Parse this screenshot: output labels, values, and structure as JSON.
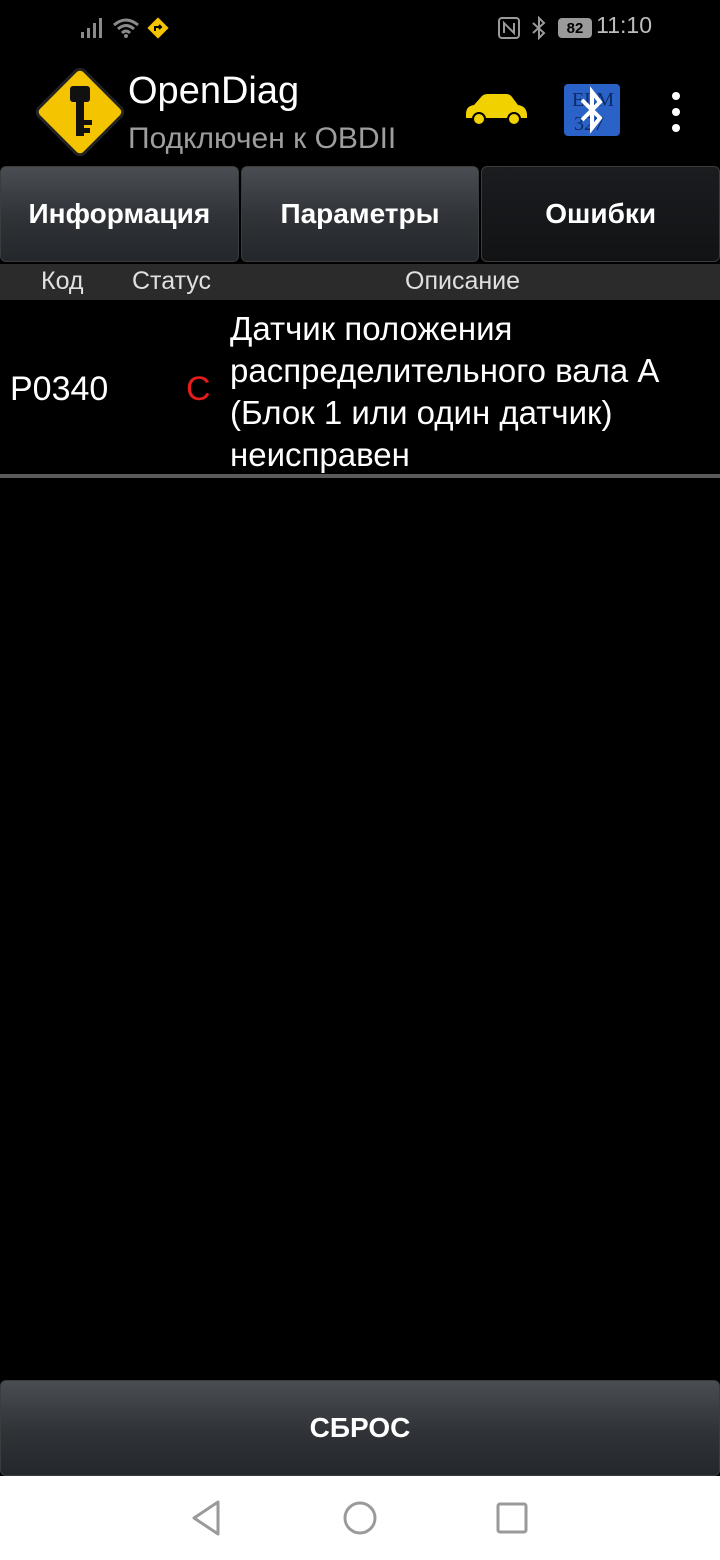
{
  "status_bar": {
    "time": "11:10",
    "battery": "82",
    "icons": [
      "signal-icon",
      "wifi-icon",
      "route-warning-icon",
      "nfc-icon",
      "bluetooth-icon",
      "battery-icon"
    ]
  },
  "app": {
    "title": "OpenDiag",
    "subtitle": "Подключен к OBDII",
    "actions": [
      "car-icon",
      "elm327-bluetooth-icon",
      "more-vert-icon"
    ],
    "elm_text_top": "ELM",
    "elm_text_bottom": "327"
  },
  "tabs": [
    {
      "label": "Информация",
      "active": false
    },
    {
      "label": "Параметры",
      "active": false
    },
    {
      "label": "Ошибки",
      "active": true
    }
  ],
  "table": {
    "columns": [
      "Код",
      "Статус",
      "Описание"
    ],
    "rows": [
      {
        "code": "P0340",
        "status": "C",
        "description": "Датчик положения распределительного вала A (Блок 1 или один датчик) неисправен"
      }
    ]
  },
  "reset_label": "СБРОС",
  "colors": {
    "status_red": "#e51c1c",
    "logo_yellow": "#f5c400",
    "elm_blue": "#2a62c8"
  }
}
